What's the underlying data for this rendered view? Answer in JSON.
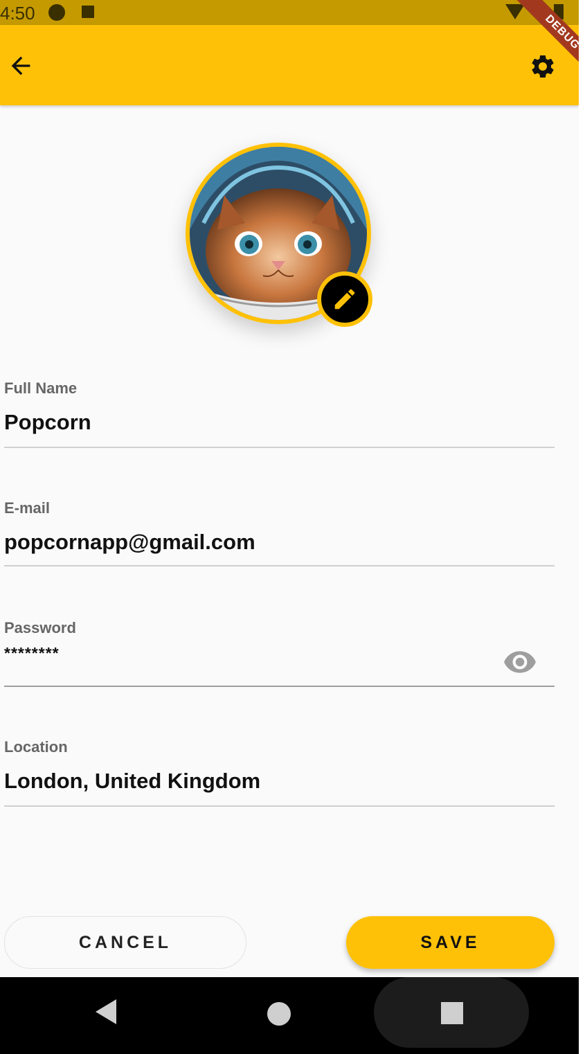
{
  "status_bar": {
    "time": "4:50"
  },
  "debug_banner": "DEBUG",
  "app_bar": {
    "back_icon": "arrow-back-icon",
    "settings_icon": "gear-icon",
    "color": "#ffc107"
  },
  "avatar": {
    "image": "kitten-photo",
    "edit_icon": "pencil-icon"
  },
  "fields": {
    "full_name": {
      "label": "Full Name",
      "value": "Popcorn"
    },
    "email": {
      "label": "E-mail",
      "value": "popcornapp@gmail.com"
    },
    "password": {
      "label": "Password",
      "value": "********",
      "toggle_icon": "eye-icon"
    },
    "location": {
      "label": "Location",
      "value": "London, United Kingdom"
    }
  },
  "buttons": {
    "cancel": "CANCEL",
    "save": "SAVE"
  },
  "nav_bar": {
    "back_icon": "triangle-back-icon",
    "home_icon": "circle-home-icon",
    "recents_icon": "square-recents-icon"
  }
}
